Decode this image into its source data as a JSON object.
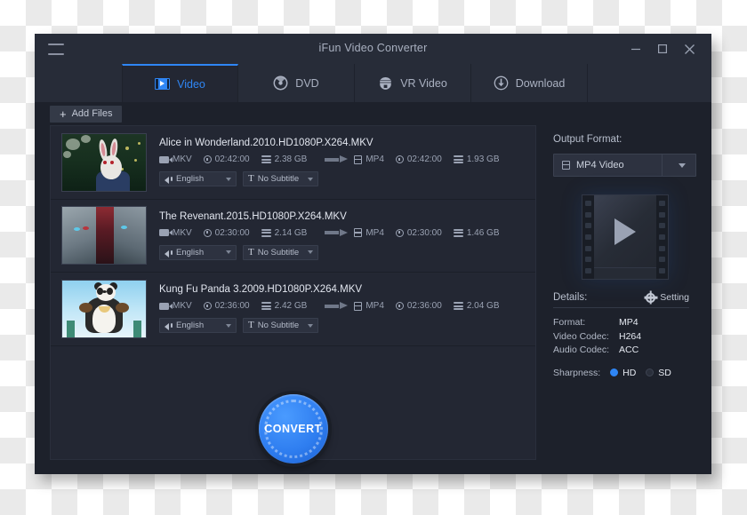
{
  "window": {
    "title": "iFun Video Converter",
    "menu_icon": "hamburger-icon",
    "minimize_label": "–",
    "maximize_label": "□",
    "close_label": "×"
  },
  "tabs": [
    {
      "label": "Video",
      "icon": "video-film-icon",
      "active": true
    },
    {
      "label": "DVD",
      "icon": "disc-icon",
      "active": false
    },
    {
      "label": "VR Video",
      "icon": "vr-headset-icon",
      "active": false
    },
    {
      "label": "Download",
      "icon": "download-icon",
      "active": false
    }
  ],
  "toolbar": {
    "add_files_label": "Add Files",
    "plus": "+"
  },
  "files": [
    {
      "name": "Alice in Wonderland.2010.HD1080P.X264.MKV",
      "thumb": "alice-thumbnail",
      "source": {
        "container": "MKV",
        "duration": "02:42:00",
        "size": "2.38 GB"
      },
      "target": {
        "container": "MP4",
        "duration": "02:42:00",
        "size": "1.93 GB"
      },
      "audio_track": "English",
      "subtitle": "No Subtitle"
    },
    {
      "name": "The Revenant.2015.HD1080P.X264.MKV",
      "thumb": "revenant-thumbnail",
      "source": {
        "container": "MKV",
        "duration": "02:30:00",
        "size": "2.14 GB"
      },
      "target": {
        "container": "MP4",
        "duration": "02:30:00",
        "size": "1.46 GB"
      },
      "audio_track": "English",
      "subtitle": "No Subtitle"
    },
    {
      "name": "Kung Fu Panda 3.2009.HD1080P.X264.MKV",
      "thumb": "kungfupanda-thumbnail",
      "source": {
        "container": "MKV",
        "duration": "02:36:00",
        "size": "2.42 GB"
      },
      "target": {
        "container": "MP4",
        "duration": "02:36:00",
        "size": "2.04 GB"
      },
      "audio_track": "English",
      "subtitle": "No Subtitle"
    }
  ],
  "sidebar": {
    "output_format_label": "Output Format:",
    "output_format_value": "MP4 Video",
    "preview_icon": "filmstrip-play-icon",
    "details_label": "Details:",
    "setting_label": "Setting",
    "details": [
      {
        "key": "Format:",
        "value": "MP4"
      },
      {
        "key": "Video Codec:",
        "value": "H264"
      },
      {
        "key": "Audio Codec:",
        "value": "ACC"
      }
    ],
    "sharpness_label": "Sharpness:",
    "sharpness_options": [
      {
        "label": "HD",
        "selected": true
      },
      {
        "label": "SD",
        "selected": false
      }
    ]
  },
  "convert": {
    "label": "CONVERT"
  },
  "colors": {
    "accent": "#2f86f5",
    "window_bg": "#1d212b",
    "panel_bg": "#232733",
    "titlebar_bg": "#272c38",
    "text_primary": "#e2e6ef",
    "text_muted": "#9aa2b3"
  }
}
